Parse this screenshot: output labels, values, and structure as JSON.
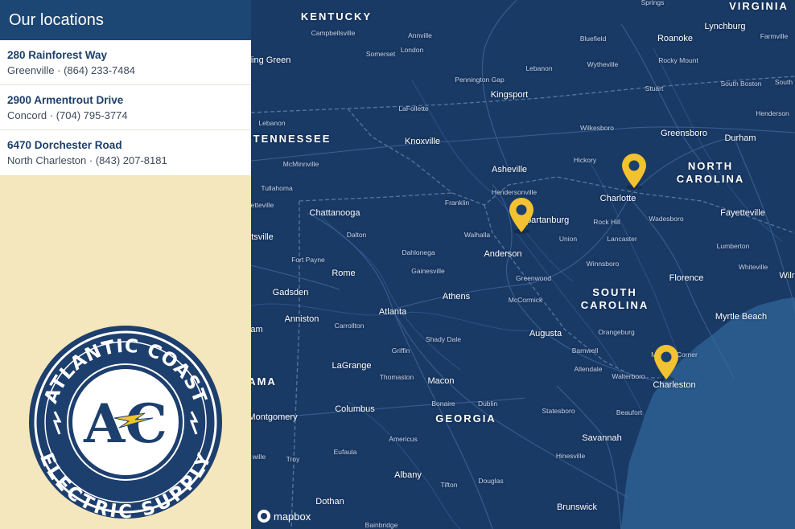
{
  "sidebar": {
    "title": "Our locations",
    "locations": [
      {
        "name": "280 Rainforest Way",
        "detail": "Greenville · (864) 233-7484"
      },
      {
        "name": "2900 Armentrout Drive",
        "detail": "Concord · (704) 795-3774"
      },
      {
        "name": "6470 Dorchester Road",
        "detail": "North Charleston · (843) 207-8181"
      }
    ]
  },
  "logo": {
    "top_text": "ATLANTIC COAST",
    "bottom_text": "ELECTRIC SUPPLY",
    "monogram": "AC",
    "colors": {
      "navy": "#1d3f6e",
      "white": "#ffffff",
      "bolt": "#f2c230",
      "cream": "#f4e6bd"
    }
  },
  "map": {
    "attribution": "mapbox",
    "colors": {
      "land": "#1a3a66",
      "water": "#2a5a8c",
      "pin": "#f2c230"
    },
    "states": [
      {
        "name": "KENTUCKY"
      },
      {
        "name": "VIRGINIA"
      },
      {
        "name": "TENNESSEE"
      },
      {
        "name": "NORTH CAROLINA"
      },
      {
        "name": "SOUTH CAROLINA"
      },
      {
        "name": "GEORGIA"
      },
      {
        "name": "AMA"
      }
    ],
    "cities": [
      {
        "name": "Campbellsville"
      },
      {
        "name": "Annville"
      },
      {
        "name": "Somerset"
      },
      {
        "name": "London"
      },
      {
        "name": "Bluefield"
      },
      {
        "name": "Roanoke"
      },
      {
        "name": "Lynchburg"
      },
      {
        "name": "Farmville"
      },
      {
        "name": "Wytheville"
      },
      {
        "name": "Rocky Mount"
      },
      {
        "name": "Lebanon"
      },
      {
        "name": "Springs"
      },
      {
        "name": "wling Green"
      },
      {
        "name": "Pennington Gap"
      },
      {
        "name": "Kingsport"
      },
      {
        "name": "Stuart"
      },
      {
        "name": "South Boston"
      },
      {
        "name": "South"
      },
      {
        "name": "LaFollette"
      },
      {
        "name": "Henderson"
      },
      {
        "name": "Lebanon"
      },
      {
        "name": "Wilkesboro"
      },
      {
        "name": "Greensboro"
      },
      {
        "name": "Durham"
      },
      {
        "name": "Knoxville"
      },
      {
        "name": "McMinnville"
      },
      {
        "name": "Hickory"
      },
      {
        "name": "Asheville"
      },
      {
        "name": "Tullahoma"
      },
      {
        "name": "Hendersonville"
      },
      {
        "name": "Charlotte"
      },
      {
        "name": "Franklin"
      },
      {
        "name": "Fayetteville"
      },
      {
        "name": "etteville"
      },
      {
        "name": "Chattanooga"
      },
      {
        "name": "Spartanburg"
      },
      {
        "name": "Rock Hill"
      },
      {
        "name": "Wadesboro"
      },
      {
        "name": "tsville"
      },
      {
        "name": "Dalton"
      },
      {
        "name": "Walhalla"
      },
      {
        "name": "Union"
      },
      {
        "name": "Lancaster"
      },
      {
        "name": "Lumberton"
      },
      {
        "name": "Dahlonega"
      },
      {
        "name": "Anderson"
      },
      {
        "name": "Fort Payne"
      },
      {
        "name": "Winnsboro"
      },
      {
        "name": "Whiteville"
      },
      {
        "name": "Rome"
      },
      {
        "name": "Gainesville"
      },
      {
        "name": "Greenwood"
      },
      {
        "name": "Florence"
      },
      {
        "name": "Wilr"
      },
      {
        "name": "Gadsden"
      },
      {
        "name": "McCormick"
      },
      {
        "name": "Athens"
      },
      {
        "name": "Atlanta"
      },
      {
        "name": "Myrtle Beach"
      },
      {
        "name": "Anniston"
      },
      {
        "name": "Carrollton"
      },
      {
        "name": "Augusta"
      },
      {
        "name": "Orangeburg"
      },
      {
        "name": "am"
      },
      {
        "name": "Shady Dale"
      },
      {
        "name": "Moncks Corner"
      },
      {
        "name": "Barnwell"
      },
      {
        "name": "Griffin"
      },
      {
        "name": "LaGrange"
      },
      {
        "name": "Allendale"
      },
      {
        "name": "Thomaston"
      },
      {
        "name": "Macon"
      },
      {
        "name": "Walterboro"
      },
      {
        "name": "Charleston"
      },
      {
        "name": "Bonaire"
      },
      {
        "name": "Dublin"
      },
      {
        "name": "Columbus"
      },
      {
        "name": "Statesboro"
      },
      {
        "name": "Beaufort"
      },
      {
        "name": "Montgomery"
      },
      {
        "name": "Americus"
      },
      {
        "name": "Savannah"
      },
      {
        "name": "Eufaula"
      },
      {
        "name": "Hinesville"
      },
      {
        "name": "wille"
      },
      {
        "name": "Troy"
      },
      {
        "name": "Albany"
      },
      {
        "name": "Douglas"
      },
      {
        "name": "Tifton"
      },
      {
        "name": "Dothan"
      },
      {
        "name": "Brunswick"
      },
      {
        "name": "Bainbridge"
      }
    ],
    "pins": [
      {
        "name": "Concord"
      },
      {
        "name": "Greenville"
      },
      {
        "name": "North Charleston"
      }
    ]
  }
}
